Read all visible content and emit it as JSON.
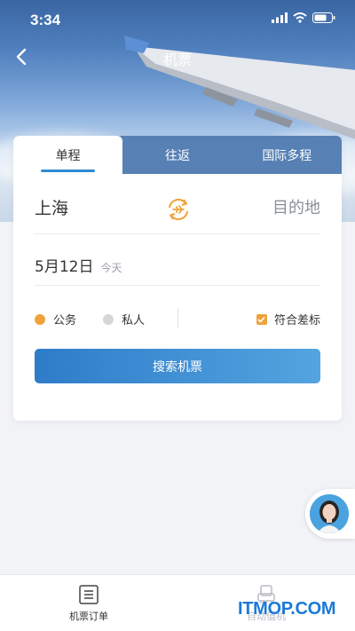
{
  "status_bar": {
    "time": "3:34"
  },
  "nav": {
    "title": "机票"
  },
  "tabs": [
    {
      "label": "单程",
      "active": true
    },
    {
      "label": "往返",
      "active": false
    },
    {
      "label": "国际多程",
      "active": false
    }
  ],
  "route": {
    "from": "上海",
    "to": "目的地"
  },
  "date": {
    "value": "5月12日",
    "hint": "今天"
  },
  "trip_type": {
    "options": [
      {
        "label": "公务",
        "selected": true,
        "color": "#f0a23a"
      },
      {
        "label": "私人",
        "selected": false,
        "color": "#d4d6da"
      }
    ],
    "policy_checkbox": {
      "label": "符合差标",
      "checked": true
    }
  },
  "search_button": {
    "label": "搜索机票"
  },
  "bottom_nav": [
    {
      "label": "机票订单",
      "icon": "order-list-icon"
    },
    {
      "label": "自动值机",
      "icon": "seat-icon"
    }
  ],
  "watermark": {
    "text": "ITMOP.COM"
  },
  "colors": {
    "accent": "#2e7cc9",
    "orange": "#f0a23a"
  }
}
